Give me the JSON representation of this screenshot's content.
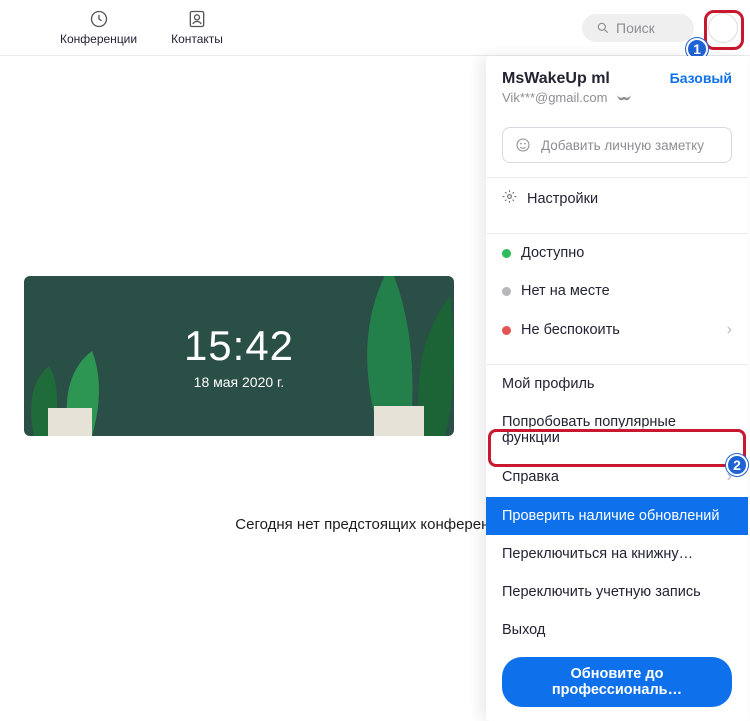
{
  "nav": {
    "conferences": "Конференции",
    "contacts": "Контакты"
  },
  "search": {
    "placeholder": "Поиск"
  },
  "clock": {
    "time": "15:42",
    "date": "18 мая 2020 г."
  },
  "empty_msg": "Сегодня нет предстоящих конференций",
  "dropdown": {
    "name": "MsWakeUp ml",
    "plan": "Базовый",
    "email": "Vik***@gmail.com",
    "note_placeholder": "Добавить личную заметку",
    "settings": "Настройки",
    "status": {
      "available": "Доступно",
      "away": "Нет на месте",
      "dnd": "Не беспокоить"
    },
    "my_profile": "Мой профиль",
    "try_features": "Попробовать популярные функции",
    "help": "Справка",
    "check_updates": "Проверить наличие обновлений",
    "portrait": "Переключиться на книжну…",
    "switch_account": "Переключить учетную запись",
    "logout": "Выход",
    "upgrade": "Обновите до профессиональ…"
  },
  "callouts": {
    "one": "1",
    "two": "2"
  }
}
